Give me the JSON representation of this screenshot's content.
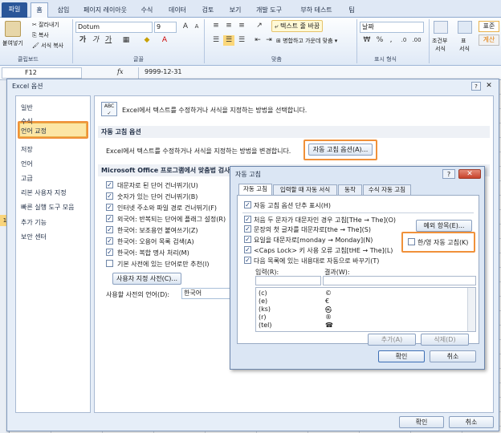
{
  "ribbon_tabs": [
    "파일",
    "홈",
    "삽입",
    "페이지 레이아웃",
    "수식",
    "데이터",
    "검토",
    "보기",
    "개발 도구",
    "부하 테스트",
    "팀"
  ],
  "ribbon": {
    "clipboard": {
      "paste": "붙여넣기",
      "cut": "잘라내기",
      "copy": "복사",
      "format_painter": "서식 복사",
      "label": "클립보드"
    },
    "font": {
      "name": "Dotum",
      "size": "9",
      "bold": "가",
      "italic": "가",
      "underline": "가",
      "label": "글꼴"
    },
    "alignment": {
      "wrap": "텍스트 줄 바꿈",
      "merge": "병합하고 가운데 맞춤",
      "label": "맞춤"
    },
    "number": {
      "format": "날짜",
      "label": "표시 형식"
    },
    "styles": {
      "conditional": "조건부",
      "conditional2": "서식",
      "table": "표",
      "table2": "서식",
      "normal": "표준",
      "calc": "계산"
    }
  },
  "formula_bar": {
    "name_box": "F12",
    "fx": "fx",
    "value": "9999-12-31"
  },
  "sheet": {
    "row_hint": "1"
  },
  "options": {
    "title": "Excel 옵션",
    "help": "?",
    "close": "✕",
    "nav": [
      "일반",
      "수식",
      "언어 교정",
      "저장",
      "언어",
      "고급",
      "리본 사용자 지정",
      "빠른 실행 도구 모음",
      "추가 기능",
      "보안 센터"
    ],
    "header_text": "Excel에서 텍스트를 수정하거나 서식을 지정하는 방법을 선택합니다.",
    "autocorrect_section": "자동 고침 옵션",
    "autocorrect_desc": "Excel에서 텍스트를 수정하거나 서식을 지정하는 방법을 변경합니다.",
    "autocorrect_button": "자동 고침 옵션(A)...",
    "office_section": "Microsoft Office 프로그램에서 맞춤법 검사",
    "checks": [
      {
        "label": "대문자로 된 단어 건너뛰기(U)",
        "mark": "✓"
      },
      {
        "label": "숫자가 있는 단어 건너뛰기(B)",
        "mark": "✓"
      },
      {
        "label": "인터넷 주소와 파일 경로 건너뛰기(F)",
        "mark": "✓"
      },
      {
        "label": "외국어: 반복되는 단어에 플래그 설정(R)",
        "mark": "✓"
      },
      {
        "label": "한국어: 보조용언 붙여쓰기(Z)",
        "mark": "✓"
      },
      {
        "label": "한국어: 오용어 목록 검색(A)",
        "mark": "✓"
      },
      {
        "label": "한국어: 복합 명사 처리(M)",
        "mark": "✓"
      },
      {
        "label": "기본 사전에 있는 단어로만 추천(I)",
        "mark": ""
      }
    ],
    "custom_dict": "사용자 지정 사전(C)...",
    "dict_lang_label": "사용할 사전의 언어(D):",
    "dict_lang_value": "한국어",
    "ok": "확인",
    "cancel": "취소"
  },
  "autocorrect": {
    "title": "자동 고침",
    "help": "?",
    "close": "✕",
    "tabs": [
      "자동 고침",
      "입력할 때 자동 서식",
      "동작",
      "수식 자동 고침"
    ],
    "show_buttons": "자동 고침 옵션 단추 표시(H)",
    "checks": [
      "처음 두 문자가 대문자인 경우 고침[THe → The](O)",
      "문장의 첫 글자를 대문자로[the → The](S)",
      "요일을 대문자로[monday → Monday](N)",
      "<Caps Lock> 키 사용 오류 고침[tHE → The](L)",
      "다음 목록에 있는 내용대로 자동으로 바꾸기(T)"
    ],
    "exceptions": "예외 항목(E)...",
    "hanyoung": "한/영 자동 고침(K)",
    "input_label": "입력(R):",
    "result_label": "결과(W):",
    "list": [
      {
        "input": "(c)",
        "result": "©"
      },
      {
        "input": "(e)",
        "result": "€"
      },
      {
        "input": "(ks)",
        "result": "㉿"
      },
      {
        "input": "(r)",
        "result": "®"
      },
      {
        "input": "(tel)",
        "result": "☎"
      }
    ],
    "add": "추가(A)",
    "delete": "삭제(D)",
    "ok": "확인",
    "cancel": "취소"
  },
  "colors": {
    "highlight": "#f0913a",
    "file_tab": "#2a5699",
    "selected_nav": "#fce6a5"
  }
}
